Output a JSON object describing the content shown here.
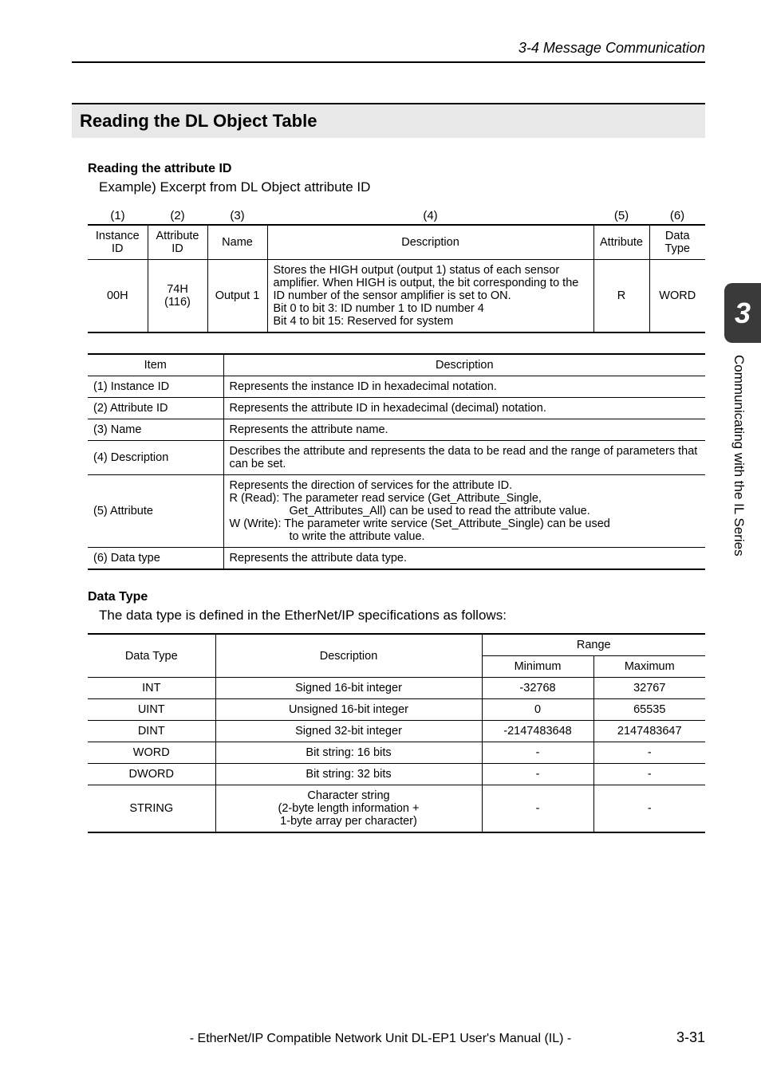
{
  "header": {
    "section_label": "3-4 Message Communication"
  },
  "section_title": "Reading the DL Object Table",
  "sub1": {
    "title": "Reading the attribute ID",
    "example_text": "Example) Excerpt from DL Object attribute ID"
  },
  "table1_labels": [
    "(1)",
    "(2)",
    "(3)",
    "(4)",
    "(5)",
    "(6)"
  ],
  "table1_headers": [
    "Instance ID",
    "Attribute ID",
    "Name",
    "Description",
    "Attribute",
    "Data Type"
  ],
  "table1_row": {
    "instance": "00H",
    "attr_id_h": "74H",
    "attr_id_d": "(116)",
    "name": "Output 1",
    "desc1": "Stores the HIGH output (output 1) status of each sensor amplifier. When HIGH is output, the bit corresponding to the ID number of the sensor amplifier is set to ON.",
    "desc2": "Bit 0 to bit 3:   ID number 1 to ID number 4",
    "desc3": "Bit 4 to bit 15: Reserved for system",
    "attribute": "R",
    "data_type": "WORD"
  },
  "table2_headers": [
    "Item",
    "Description"
  ],
  "table2_rows": [
    {
      "item": "(1) Instance ID",
      "desc": "Represents the instance ID in hexadecimal notation."
    },
    {
      "item": "(2) Attribute ID",
      "desc": "Represents the attribute ID in hexadecimal (decimal) notation."
    },
    {
      "item": "(3) Name",
      "desc": "Represents the attribute name."
    },
    {
      "item": "(4) Description",
      "desc": "Describes the attribute and represents the data to be read and the range of parameters that can be set."
    },
    {
      "item": "(5) Attribute",
      "desc_multi": {
        "l1": "Represents the direction of services for the attribute ID.",
        "l2": "R (Read):  The parameter read service (Get_Attribute_Single,",
        "l3": "Get_Attributes_All) can be used to read the attribute value.",
        "l4": "W (Write):  The parameter write service (Set_Attribute_Single) can be used",
        "l5": "to write the attribute value."
      }
    },
    {
      "item": "(6) Data type",
      "desc": "Represents the attribute data type."
    }
  ],
  "sub2": {
    "title": "Data Type",
    "text": "The data type is defined in the EtherNet/IP specifications as follows:"
  },
  "table3_headers": {
    "dt": "Data Type",
    "desc": "Description",
    "range": "Range",
    "min": "Minimum",
    "max": "Maximum"
  },
  "table3_rows": [
    {
      "dt": "INT",
      "desc": "Signed 16-bit integer",
      "min": "-32768",
      "max": "32767"
    },
    {
      "dt": "UINT",
      "desc": "Unsigned 16-bit integer",
      "min": "0",
      "max": "65535"
    },
    {
      "dt": "DINT",
      "desc": "Signed 32-bit integer",
      "min": "-2147483648",
      "max": "2147483647"
    },
    {
      "dt": "WORD",
      "desc": "Bit string: 16 bits",
      "min": "-",
      "max": "-"
    },
    {
      "dt": "DWORD",
      "desc": "Bit string: 32 bits",
      "min": "-",
      "max": "-"
    },
    {
      "dt": "STRING",
      "desc_lines": [
        "Character string",
        "(2-byte length information +",
        "1-byte array per character)"
      ],
      "min": "-",
      "max": "-"
    }
  ],
  "tab": {
    "number": "3",
    "text": "Communicating with the IL Series"
  },
  "footer": "- EtherNet/IP Compatible Network Unit DL-EP1 User's Manual (IL) -",
  "page_num": "3-31"
}
